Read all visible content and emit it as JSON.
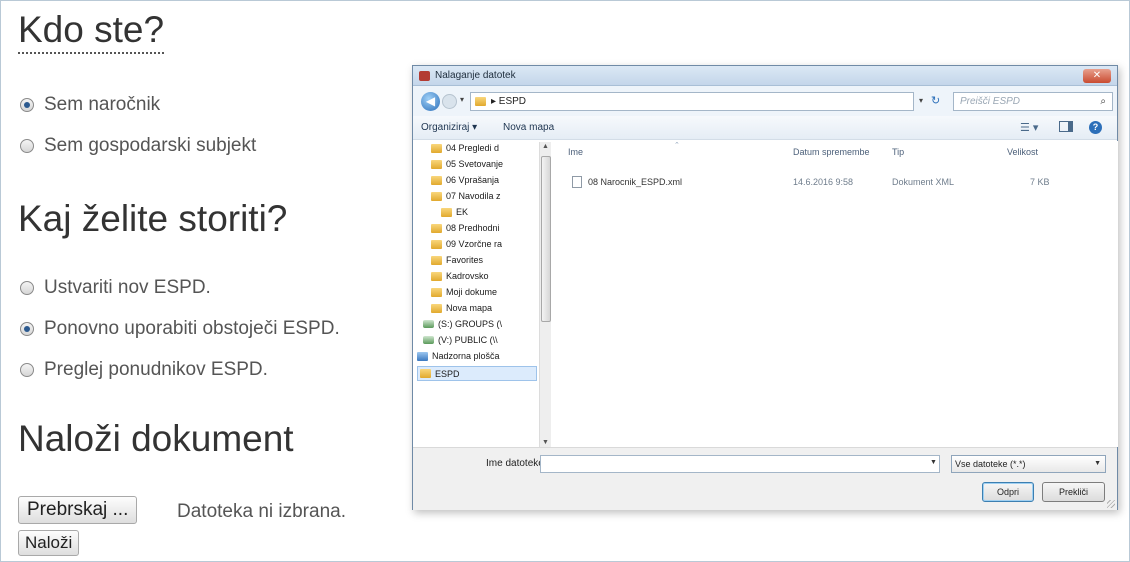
{
  "form": {
    "who_heading": "Kdo ste?",
    "who_options": [
      {
        "label": "Sem naročnik",
        "checked": true
      },
      {
        "label": "Sem gospodarski subjekt",
        "checked": false
      }
    ],
    "action_heading": "Kaj želite storiti?",
    "action_options": [
      {
        "label": "Ustvariti nov ESPD.",
        "checked": false
      },
      {
        "label": "Ponovno uporabiti obstoječi ESPD.",
        "checked": true
      },
      {
        "label": "Preglej ponudnikov ESPD.",
        "checked": false
      }
    ],
    "upload_heading": "Naloži dokument",
    "browse_label": "Prebrskaj ...",
    "file_status": "Datoteka ni izbrana.",
    "upload_label": "Naloži"
  },
  "dialog": {
    "title": "Nalaganje datotek",
    "close_glyph": "✕",
    "address": "▸ ESPD",
    "search_placeholder": "Preišči ESPD",
    "toolbar": {
      "organize": "Organiziraj ▾",
      "new_folder": "Nova mapa",
      "view_glyph": "☰ ▾",
      "help_glyph": "?"
    },
    "nav_items": [
      {
        "label": "04 Pregledi d",
        "icon": "folder"
      },
      {
        "label": "05 Svetovanje",
        "icon": "folder"
      },
      {
        "label": "06 Vprašanja",
        "icon": "folder"
      },
      {
        "label": "07 Navodila z",
        "icon": "folder"
      },
      {
        "label": "EK",
        "icon": "folder"
      },
      {
        "label": "08 Predhodni",
        "icon": "folder"
      },
      {
        "label": "09 Vzorčne ra",
        "icon": "folder"
      },
      {
        "label": "Favorites",
        "icon": "folder"
      },
      {
        "label": "Kadrovsko",
        "icon": "folder"
      },
      {
        "label": "Moji dokume",
        "icon": "folder"
      },
      {
        "label": "Nova mapa",
        "icon": "folder"
      },
      {
        "label": "(S:) GROUPS (\\",
        "icon": "network-drive"
      },
      {
        "label": "(V:) PUBLIC (\\\\",
        "icon": "network-drive"
      },
      {
        "label": "Nadzorna plošča",
        "icon": "control-panel"
      },
      {
        "label": "ESPD",
        "icon": "folder",
        "selected": true
      }
    ],
    "columns": {
      "name": "Ime",
      "date": "Datum spremembe",
      "type": "Tip",
      "size": "Velikost"
    },
    "files": [
      {
        "name": "08 Narocnik_ESPD.xml",
        "date": "14.6.2016 9:58",
        "type": "Dokument XML",
        "size": "7 KB"
      }
    ],
    "filename_label": "Ime datoteke:",
    "filename_value": "",
    "filetype": "Vse datoteke (*.*)",
    "open_label": "Odpri",
    "cancel_label": "Prekliči"
  }
}
